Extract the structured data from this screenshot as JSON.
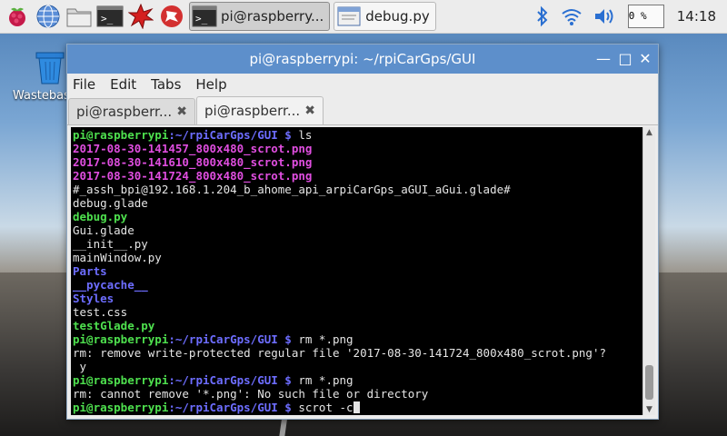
{
  "desktop": {
    "trash_label": "Wastebasket"
  },
  "taskbar": {
    "tasks": [
      {
        "label": "pi@raspberry..."
      },
      {
        "label": "debug.py"
      }
    ],
    "cpu": "0 %",
    "clock": "14:18"
  },
  "window": {
    "title": "pi@raspberrypi: ~/rpiCarGps/GUI",
    "menu": [
      "File",
      "Edit",
      "Tabs",
      "Help"
    ],
    "tabs": [
      {
        "label": "pi@raspberr..."
      },
      {
        "label": "pi@raspberr..."
      }
    ]
  },
  "terminal": {
    "prompt_user": "pi@raspberrypi",
    "prompt_path": ":~/rpiCarGps/GUI $",
    "lines": [
      {
        "type": "prompt",
        "cmd": " ls"
      },
      {
        "type": "m",
        "text": "2017-08-30-141457_800x480_scrot.png"
      },
      {
        "type": "m",
        "text": "2017-08-30-141610_800x480_scrot.png"
      },
      {
        "type": "m",
        "text": "2017-08-30-141724_800x480_scrot.png"
      },
      {
        "type": "w",
        "text": "#_assh_bpi@192.168.1.204_b_ahome_api_arpiCarGps_aGUI_aGui.glade#"
      },
      {
        "type": "w",
        "text": "debug.glade"
      },
      {
        "type": "g",
        "text": "debug.py"
      },
      {
        "type": "w",
        "text": "Gui.glade"
      },
      {
        "type": "w",
        "text": "__init__.py"
      },
      {
        "type": "w",
        "text": "mainWindow.py"
      },
      {
        "type": "b",
        "text": "Parts"
      },
      {
        "type": "b",
        "text": "__pycache__"
      },
      {
        "type": "b",
        "text": "Styles"
      },
      {
        "type": "w",
        "text": "test.css"
      },
      {
        "type": "g",
        "text": "testGlade.py"
      },
      {
        "type": "prompt",
        "cmd": " rm *.png"
      },
      {
        "type": "w",
        "text": "rm: remove write-protected regular file '2017-08-30-141724_800x480_scrot.png'?"
      },
      {
        "type": "w",
        "text": " y"
      },
      {
        "type": "prompt",
        "cmd": " rm *.png"
      },
      {
        "type": "w",
        "text": "rm: cannot remove '*.png': No such file or directory"
      },
      {
        "type": "prompt",
        "cmd": " scrot -c"
      }
    ]
  }
}
